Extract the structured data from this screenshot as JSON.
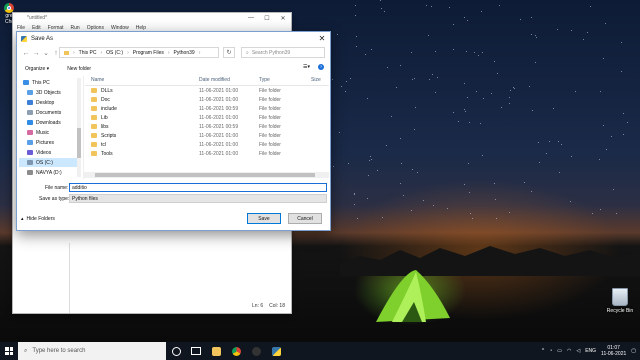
{
  "desktop": {
    "recycle_bin_label": "Recycle Bin",
    "chrome_label_1": "gre",
    "chrome_label_2": "Chr"
  },
  "idle": {
    "title": "*untitled*",
    "menu": [
      "File",
      "Edit",
      "Format",
      "Run",
      "Options",
      "Window",
      "Help"
    ],
    "status_ln": "Ln: 6",
    "status_col": "Col: 18"
  },
  "dialog": {
    "title": "Save As",
    "breadcrumbs": [
      "This PC",
      "OS (C:)",
      "Program Files",
      "Python39"
    ],
    "search_placeholder": "Search Python39",
    "organize_label": "Organize ▾",
    "new_folder_label": "New folder",
    "columns": {
      "name": "Name",
      "date": "Date modified",
      "type": "Type",
      "size": "Size"
    },
    "nav_items": [
      {
        "label": "This PC",
        "color": "#3a8ee6"
      },
      {
        "label": "3D Objects",
        "color": "#5aa0e6"
      },
      {
        "label": "Desktop",
        "color": "#3b7fd6"
      },
      {
        "label": "Documents",
        "color": "#8f9fb2"
      },
      {
        "label": "Downloads",
        "color": "#2f8be6"
      },
      {
        "label": "Music",
        "color": "#d46aa0"
      },
      {
        "label": "Pictures",
        "color": "#5aa0e6"
      },
      {
        "label": "Videos",
        "color": "#6c5bd6"
      },
      {
        "label": "OS (C:)",
        "color": "#7f96b0"
      },
      {
        "label": "NAVYA (D:)",
        "color": "#8c8c8c"
      }
    ],
    "files": [
      {
        "name": "DLLs",
        "date": "11-06-2021 01:00",
        "type": "File folder"
      },
      {
        "name": "Doc",
        "date": "11-06-2021 01:00",
        "type": "File folder"
      },
      {
        "name": "include",
        "date": "11-06-2021 00:59",
        "type": "File folder"
      },
      {
        "name": "Lib",
        "date": "11-06-2021 01:00",
        "type": "File folder"
      },
      {
        "name": "libs",
        "date": "11-06-2021 00:59",
        "type": "File folder"
      },
      {
        "name": "Scripts",
        "date": "11-06-2021 01:00",
        "type": "File folder"
      },
      {
        "name": "tcl",
        "date": "11-06-2021 01:00",
        "type": "File folder"
      },
      {
        "name": "Tools",
        "date": "11-06-2021 01:00",
        "type": "File folder"
      }
    ],
    "file_name_label": "File name:",
    "file_name_value": "additio",
    "save_type_label": "Save as type:",
    "save_type_value": "Python files",
    "hide_folders_label": "Hide Folders",
    "save_label": "Save",
    "cancel_label": "Cancel"
  },
  "taskbar": {
    "search_placeholder": "Type here to search",
    "lang": "ENG",
    "time": "01:07",
    "date": "11-06-2021"
  },
  "colors": {
    "accent": "#0078d7",
    "folder": "#f2c55c",
    "selected_nav": "#cce8ff",
    "taskbar": "#0f1620"
  }
}
